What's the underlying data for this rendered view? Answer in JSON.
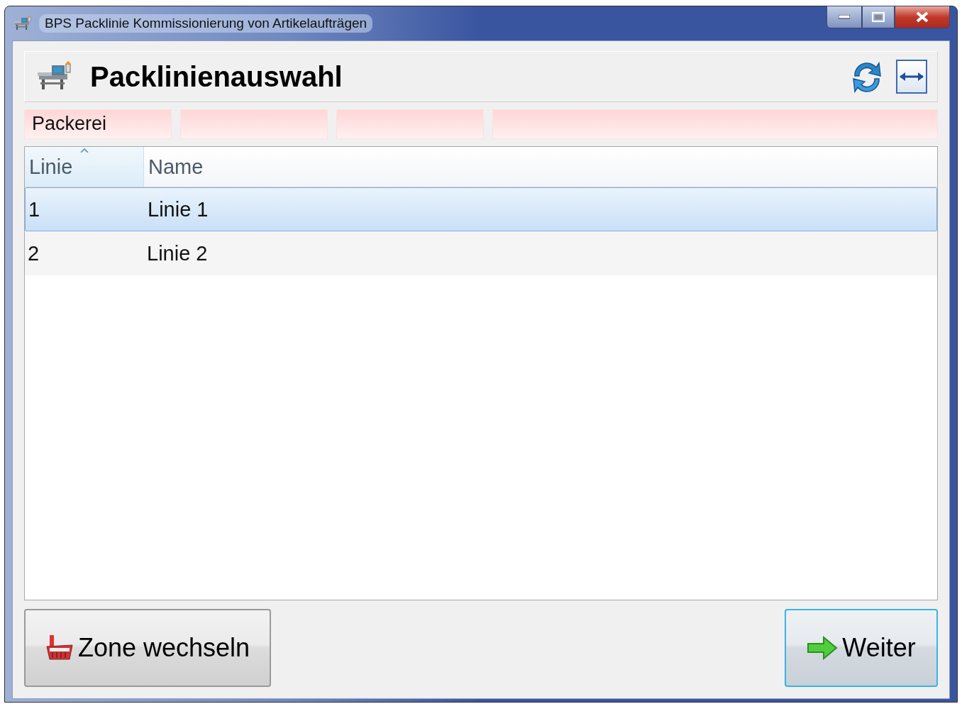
{
  "window": {
    "title": "BPS Packlinie Kommissionierung von Artikelaufträgen"
  },
  "header": {
    "title": "Packlinienauswahl"
  },
  "filter_fields": [
    {
      "kind": "filled",
      "value": "Packerei"
    },
    {
      "kind": "empty"
    },
    {
      "kind": "empty"
    },
    {
      "kind": "empty"
    }
  ],
  "table": {
    "columns": [
      {
        "label": "Linie",
        "sorted": true
      },
      {
        "label": "Name",
        "sorted": false
      }
    ],
    "rows": [
      {
        "cells": [
          "1",
          "Linie 1"
        ],
        "selected": true
      },
      {
        "cells": [
          "2",
          "Linie 2"
        ],
        "selected": false
      }
    ]
  },
  "buttons": [
    {
      "kind": "zone",
      "label": "Zone wechseln",
      "default": false
    },
    {
      "kind": "next",
      "label": "Weiter",
      "default": true
    }
  ]
}
